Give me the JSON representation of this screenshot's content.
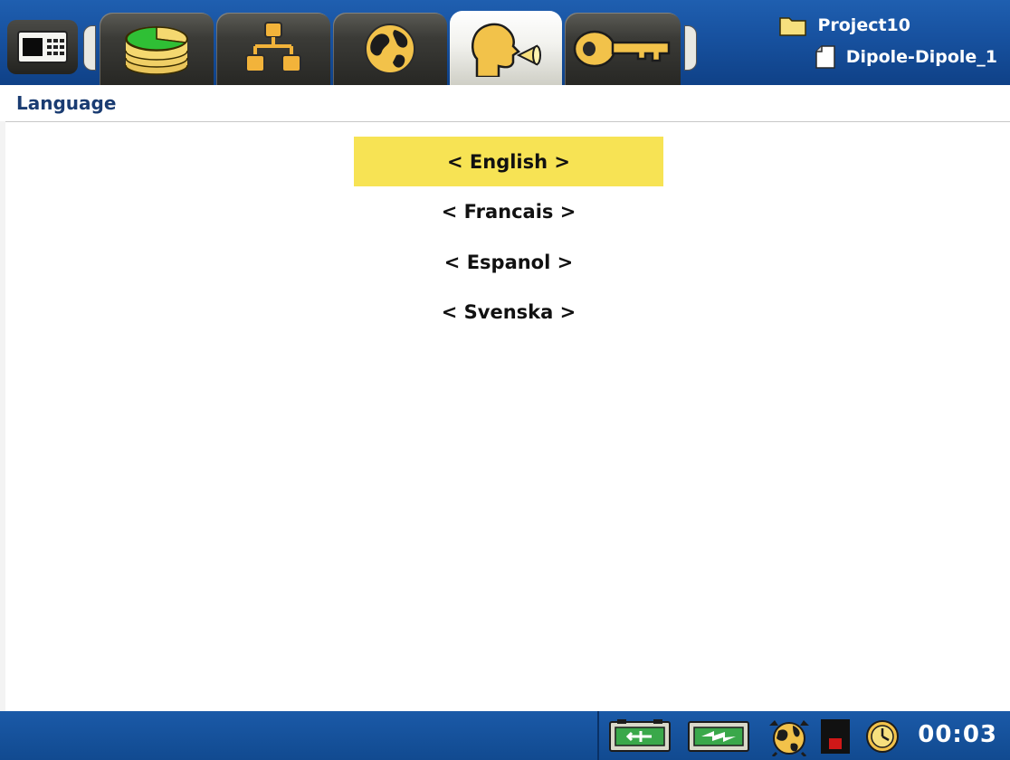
{
  "header": {
    "tabs": [
      {
        "name": "database-icon"
      },
      {
        "name": "network-icon"
      },
      {
        "name": "globe-icon"
      },
      {
        "name": "language-speaker-icon",
        "active": true
      },
      {
        "name": "key-icon"
      }
    ],
    "project_name": "Project10",
    "file_name": "Dipole-Dipole_1"
  },
  "page": {
    "title": "Language"
  },
  "languages": [
    {
      "label": "< English >",
      "selected": true
    },
    {
      "label": "< Francais >"
    },
    {
      "label": "< Espanol >"
    },
    {
      "label": "< Svenska >"
    }
  ],
  "statusbar": {
    "icons": [
      "battery-charging-icon",
      "battery-icon",
      "gps-alarm-icon",
      "record-indicator-icon",
      "timer-icon"
    ],
    "clock": "00:03"
  },
  "colors": {
    "topbar": "#17519f",
    "highlight": "#f7e354",
    "title_text": "#1a3c72"
  }
}
